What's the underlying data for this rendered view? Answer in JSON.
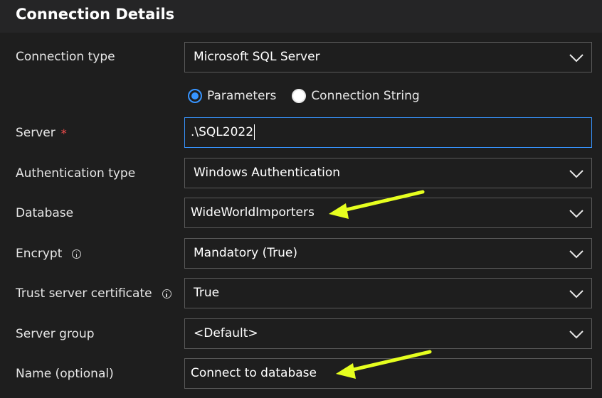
{
  "header": {
    "title": "Connection Details"
  },
  "form": {
    "connection_type": {
      "label": "Connection type",
      "value": "Microsoft SQL Server"
    },
    "input_mode": {
      "options": [
        "Parameters",
        "Connection String"
      ],
      "selected": "Parameters"
    },
    "server": {
      "label": "Server",
      "required_mark": "*",
      "value": ".\\SQL2022"
    },
    "authentication_type": {
      "label": "Authentication type",
      "value": "Windows Authentication"
    },
    "database": {
      "label": "Database",
      "value": "WideWorldImporters"
    },
    "encrypt": {
      "label": "Encrypt",
      "value": "Mandatory (True)"
    },
    "trust_server_certificate": {
      "label": "Trust server certificate",
      "value": "True"
    },
    "server_group": {
      "label": "Server group",
      "value": "<Default>"
    },
    "name": {
      "label": "Name (optional)",
      "value": "Connect to database"
    }
  },
  "colors": {
    "background": "#1e1e1e",
    "header": "#252526",
    "focus_border": "#3794ff",
    "annotation_arrow": "#e6ff1f",
    "required": "#f14c4c"
  },
  "icons": {
    "dropdown": "chevron-down-icon",
    "info": "info-icon"
  }
}
